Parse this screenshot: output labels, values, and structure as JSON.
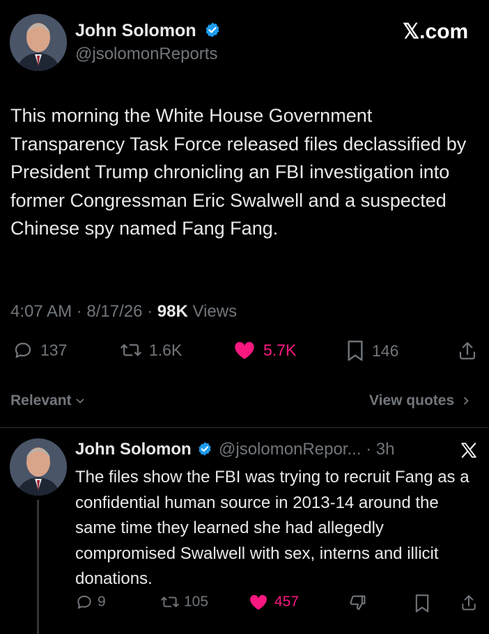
{
  "post": {
    "author_name": "John Solomon",
    "handle": "@jsolomonReports",
    "brand": "𝕏.com",
    "text": "This morning the White House Government Transparency Task Force released files declassified by President Trump chronicling an FBI investigation into former Congressman Eric Swalwell and a suspected Chinese spy named Fang Fang.",
    "time": "4:07 AM · 8/17/26 · ",
    "views_count": "98K",
    "views_label": " Views",
    "replies": "137",
    "reposts": "1.6K",
    "likes": "5.7K",
    "bookmarks": "146"
  },
  "filters": {
    "sort_label": "Relevant",
    "quotes_label": "View quotes"
  },
  "reply": {
    "author_name": "John Solomon",
    "handle_time": "@jsolomonRepor... · 3h",
    "text": "The files show the FBI was trying to recruit Fang as a confidential human source in 2013-14 around the same time they learned she had allegedly compromised Swalwell with sex, interns and illicit donations.",
    "replies": "9",
    "reposts": "105",
    "likes": "457"
  },
  "colors": {
    "background": "#000000",
    "text": "#e7e9ea",
    "muted": "#71767b",
    "like": "#f91880",
    "verified": "#1d9bf0"
  },
  "icons": [
    "verified-badge-icon",
    "reply-icon",
    "repost-icon",
    "heart-icon",
    "bookmark-icon",
    "share-icon",
    "x-logo-icon",
    "dislike-icon",
    "chevron-down-icon",
    "chevron-right-icon"
  ]
}
